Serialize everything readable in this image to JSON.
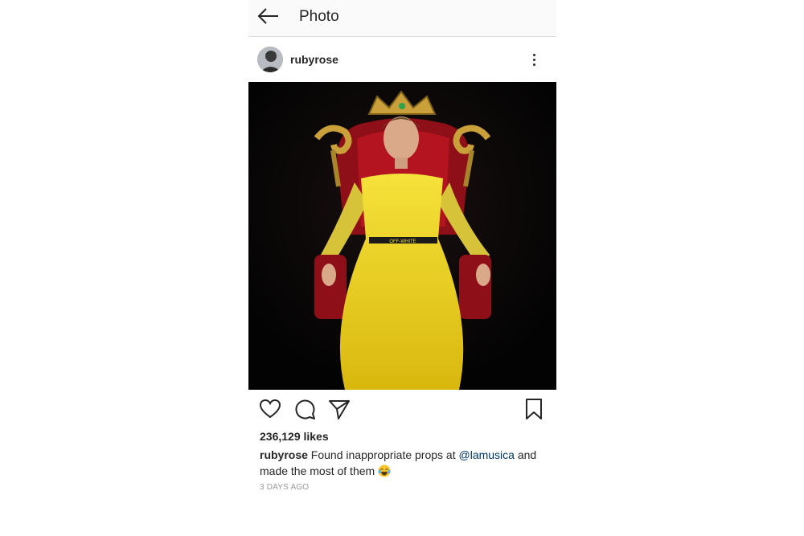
{
  "header": {
    "title": "Photo",
    "back_icon": "arrow-left-icon"
  },
  "post": {
    "username": "rubyrose",
    "more_icon": "vertical-ellipsis-icon",
    "image_description_icon": "photo",
    "actions": {
      "like_icon": "heart-outline-icon",
      "comment_icon": "speech-bubble-icon",
      "share_icon": "paper-plane-icon",
      "save_icon": "bookmark-outline-icon"
    },
    "likes": "236,129 likes",
    "caption": {
      "user": "rubyrose",
      "text_before_mention": " Found inappropriate props at ",
      "mention": "@lamusica",
      "text_after_mention": " and made the most of them ",
      "emoji": "😂"
    },
    "timestamp": "3 DAYS AGO"
  },
  "colors": {
    "mention": "#003569",
    "topbar_bg": "#fafafa",
    "text": "#262626",
    "muted": "#999999"
  }
}
